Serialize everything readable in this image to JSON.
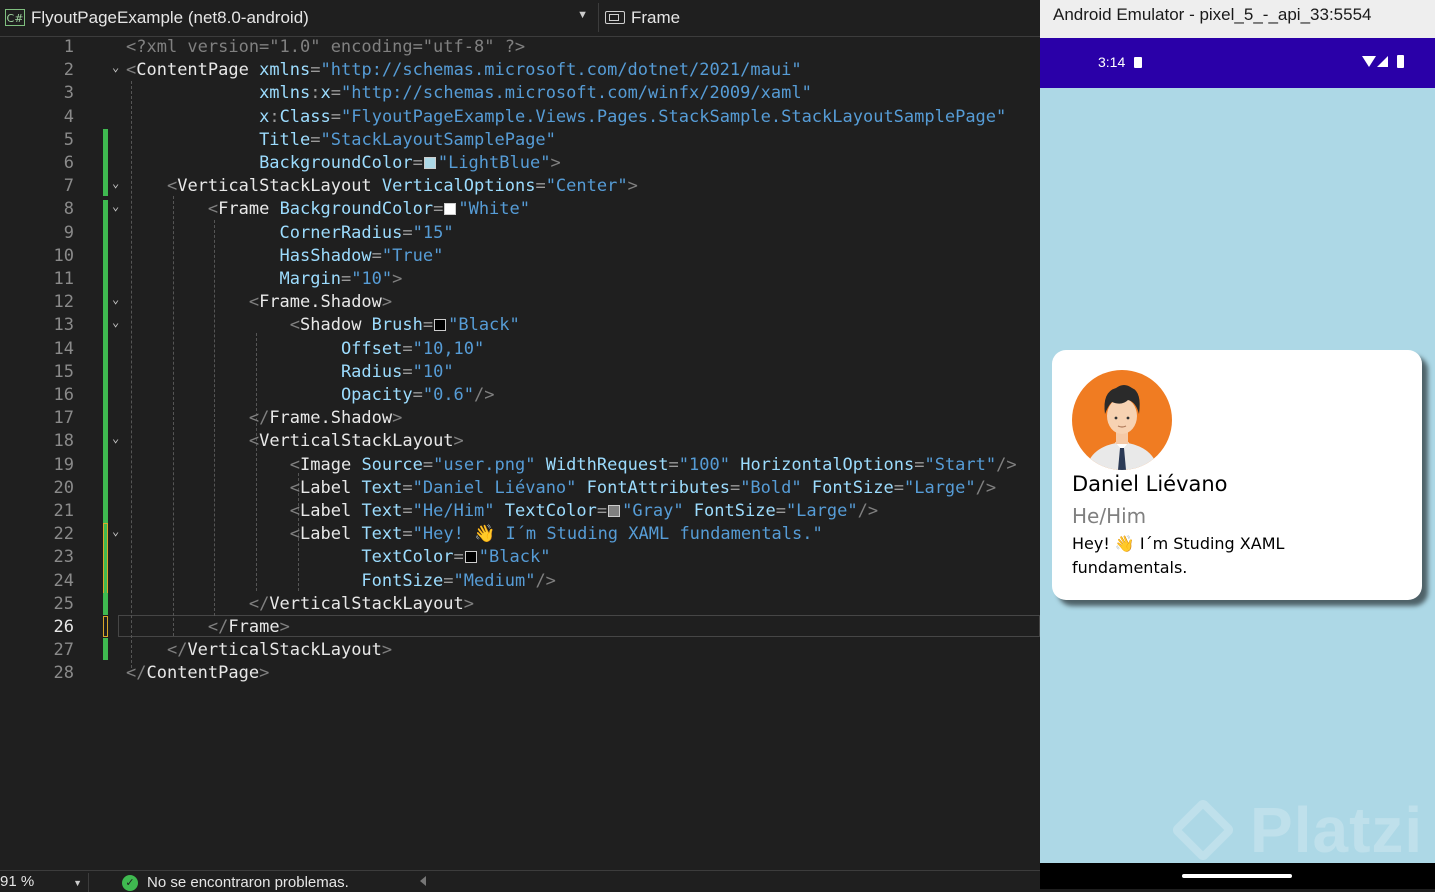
{
  "editor": {
    "project_selector": "FlyoutPageExample (net8.0-android)",
    "project_badge": "C#",
    "member_selector": "Frame",
    "lines": [
      {
        "n": "1",
        "segs": [
          [
            "b",
            "<?xml version=\"1.0\" encoding=\"utf-8\" ?>"
          ]
        ]
      },
      {
        "n": "2",
        "segs": [
          [
            "b",
            "<"
          ],
          [
            "t",
            "ContentPage "
          ],
          [
            "a",
            "xmlns"
          ],
          [
            "p",
            "="
          ],
          [
            "s",
            "\"http://schemas.microsoft.com/dotnet/2021/maui\""
          ]
        ]
      },
      {
        "n": "3",
        "segs": [
          [
            "p",
            "             "
          ],
          [
            "a",
            "xmlns"
          ],
          [
            "p",
            ":"
          ],
          [
            "a",
            "x"
          ],
          [
            "p",
            "="
          ],
          [
            "s",
            "\"http://schemas.microsoft.com/winfx/2009/xaml\""
          ]
        ]
      },
      {
        "n": "4",
        "segs": [
          [
            "p",
            "             "
          ],
          [
            "a",
            "x"
          ],
          [
            "p",
            ":"
          ],
          [
            "a",
            "Class"
          ],
          [
            "p",
            "="
          ],
          [
            "s",
            "\"FlyoutPageExample.Views.Pages.StackSample.StackLayoutSamplePage\""
          ]
        ]
      },
      {
        "n": "5",
        "segs": [
          [
            "p",
            "             "
          ],
          [
            "a",
            "Title"
          ],
          [
            "p",
            "="
          ],
          [
            "s",
            "\"StackLayoutSamplePage\""
          ]
        ]
      },
      {
        "n": "6",
        "segs": [
          [
            "p",
            "             "
          ],
          [
            "a",
            "BackgroundColor"
          ],
          [
            "p",
            "="
          ],
          [
            "sw",
            "#add8e6"
          ],
          [
            "s",
            "\"LightBlue\""
          ],
          [
            "b",
            ">"
          ]
        ]
      },
      {
        "n": "7",
        "segs": [
          [
            "p",
            "    "
          ],
          [
            "b",
            "<"
          ],
          [
            "t",
            "VerticalStackLayout "
          ],
          [
            "a",
            "VerticalOptions"
          ],
          [
            "p",
            "="
          ],
          [
            "s",
            "\"Center\""
          ],
          [
            "b",
            ">"
          ]
        ]
      },
      {
        "n": "8",
        "segs": [
          [
            "p",
            "        "
          ],
          [
            "b",
            "<"
          ],
          [
            "t",
            "Frame "
          ],
          [
            "a",
            "BackgroundColor"
          ],
          [
            "p",
            "="
          ],
          [
            "sw",
            "#ffffff"
          ],
          [
            "s",
            "\"White\""
          ]
        ]
      },
      {
        "n": "9",
        "segs": [
          [
            "p",
            "               "
          ],
          [
            "a",
            "CornerRadius"
          ],
          [
            "p",
            "="
          ],
          [
            "s",
            "\"15\""
          ]
        ]
      },
      {
        "n": "10",
        "segs": [
          [
            "p",
            "               "
          ],
          [
            "a",
            "HasShadow"
          ],
          [
            "p",
            "="
          ],
          [
            "s",
            "\"True\""
          ]
        ]
      },
      {
        "n": "11",
        "segs": [
          [
            "p",
            "               "
          ],
          [
            "a",
            "Margin"
          ],
          [
            "p",
            "="
          ],
          [
            "s",
            "\"10\""
          ],
          [
            "b",
            ">"
          ]
        ]
      },
      {
        "n": "12",
        "segs": [
          [
            "p",
            "            "
          ],
          [
            "b",
            "<"
          ],
          [
            "t",
            "Frame.Shadow"
          ],
          [
            "b",
            ">"
          ]
        ]
      },
      {
        "n": "13",
        "segs": [
          [
            "p",
            "                "
          ],
          [
            "b",
            "<"
          ],
          [
            "t",
            "Shadow "
          ],
          [
            "a",
            "Brush"
          ],
          [
            "p",
            "="
          ],
          [
            "sw",
            "#000000"
          ],
          [
            "s",
            "\"Black\""
          ]
        ]
      },
      {
        "n": "14",
        "segs": [
          [
            "p",
            "                     "
          ],
          [
            "a",
            "Offset"
          ],
          [
            "p",
            "="
          ],
          [
            "s",
            "\"10,10\""
          ]
        ]
      },
      {
        "n": "15",
        "segs": [
          [
            "p",
            "                     "
          ],
          [
            "a",
            "Radius"
          ],
          [
            "p",
            "="
          ],
          [
            "s",
            "\"10\""
          ]
        ]
      },
      {
        "n": "16",
        "segs": [
          [
            "p",
            "                     "
          ],
          [
            "a",
            "Opacity"
          ],
          [
            "p",
            "="
          ],
          [
            "s",
            "\"0.6\""
          ],
          [
            "b",
            "/>"
          ]
        ]
      },
      {
        "n": "17",
        "segs": [
          [
            "p",
            "            "
          ],
          [
            "b",
            "</"
          ],
          [
            "t",
            "Frame.Shadow"
          ],
          [
            "b",
            ">"
          ]
        ]
      },
      {
        "n": "18",
        "segs": [
          [
            "p",
            "            "
          ],
          [
            "b",
            "<"
          ],
          [
            "t",
            "VerticalStackLayout"
          ],
          [
            "b",
            ">"
          ]
        ]
      },
      {
        "n": "19",
        "segs": [
          [
            "p",
            "                "
          ],
          [
            "b",
            "<"
          ],
          [
            "t",
            "Image "
          ],
          [
            "a",
            "Source"
          ],
          [
            "p",
            "="
          ],
          [
            "s",
            "\"user.png\" "
          ],
          [
            "a",
            "WidthRequest"
          ],
          [
            "p",
            "="
          ],
          [
            "s",
            "\"100\" "
          ],
          [
            "a",
            "HorizontalOptions"
          ],
          [
            "p",
            "="
          ],
          [
            "s",
            "\"Start\""
          ],
          [
            "b",
            "/>"
          ]
        ]
      },
      {
        "n": "20",
        "segs": [
          [
            "p",
            "                "
          ],
          [
            "b",
            "<"
          ],
          [
            "t",
            "Label "
          ],
          [
            "a",
            "Text"
          ],
          [
            "p",
            "="
          ],
          [
            "s",
            "\"Daniel Liévano\" "
          ],
          [
            "a",
            "FontAttributes"
          ],
          [
            "p",
            "="
          ],
          [
            "s",
            "\"Bold\" "
          ],
          [
            "a",
            "FontSize"
          ],
          [
            "p",
            "="
          ],
          [
            "s",
            "\"Large\""
          ],
          [
            "b",
            "/>"
          ]
        ]
      },
      {
        "n": "21",
        "segs": [
          [
            "p",
            "                "
          ],
          [
            "b",
            "<"
          ],
          [
            "t",
            "Label "
          ],
          [
            "a",
            "Text"
          ],
          [
            "p",
            "="
          ],
          [
            "s",
            "\"He/Him\" "
          ],
          [
            "a",
            "TextColor"
          ],
          [
            "p",
            "="
          ],
          [
            "sw",
            "#808080"
          ],
          [
            "s",
            "\"Gray\" "
          ],
          [
            "a",
            "FontSize"
          ],
          [
            "p",
            "="
          ],
          [
            "s",
            "\"Large\""
          ],
          [
            "b",
            "/>"
          ]
        ]
      },
      {
        "n": "22",
        "segs": [
          [
            "p",
            "                "
          ],
          [
            "b",
            "<"
          ],
          [
            "t",
            "Label "
          ],
          [
            "a",
            "Text"
          ],
          [
            "p",
            "="
          ],
          [
            "s",
            "\"Hey! 👋 I´m Studing XAML fundamentals.\""
          ]
        ]
      },
      {
        "n": "23",
        "segs": [
          [
            "p",
            "                       "
          ],
          [
            "a",
            "TextColor"
          ],
          [
            "p",
            "="
          ],
          [
            "sw",
            "#000000"
          ],
          [
            "s",
            "\"Black\""
          ]
        ]
      },
      {
        "n": "24",
        "segs": [
          [
            "p",
            "                       "
          ],
          [
            "a",
            "FontSize"
          ],
          [
            "p",
            "="
          ],
          [
            "s",
            "\"Medium\""
          ],
          [
            "b",
            "/>"
          ]
        ]
      },
      {
        "n": "25",
        "segs": [
          [
            "p",
            "            "
          ],
          [
            "b",
            "</"
          ],
          [
            "t",
            "VerticalStackLayout"
          ],
          [
            "b",
            ">"
          ]
        ]
      },
      {
        "n": "26",
        "segs": [
          [
            "p",
            "        "
          ],
          [
            "b",
            "</"
          ],
          [
            "t",
            "Frame"
          ],
          [
            "b",
            ">"
          ]
        ]
      },
      {
        "n": "27",
        "segs": [
          [
            "p",
            "    "
          ],
          [
            "b",
            "</"
          ],
          [
            "t",
            "VerticalStackLayout"
          ],
          [
            "b",
            ">"
          ]
        ]
      },
      {
        "n": "28",
        "segs": [
          [
            "b",
            "</"
          ],
          [
            "t",
            "ContentPage"
          ],
          [
            "b",
            ">"
          ]
        ]
      }
    ],
    "current_line": "26"
  },
  "status_bar": {
    "zoom": "91 %",
    "problems": "No se encontraron problemas."
  },
  "emulator": {
    "window_title": "Android Emulator - pixel_5_-_api_33:5554",
    "time": "3:14",
    "status_color": "#2a00a8",
    "background": "#add8e6",
    "card": {
      "name": "Daniel Liévano",
      "pronouns": "He/Him",
      "bio": "Hey! 👋 I´m Studing XAML fundamentals."
    },
    "watermark": "Platzi"
  }
}
